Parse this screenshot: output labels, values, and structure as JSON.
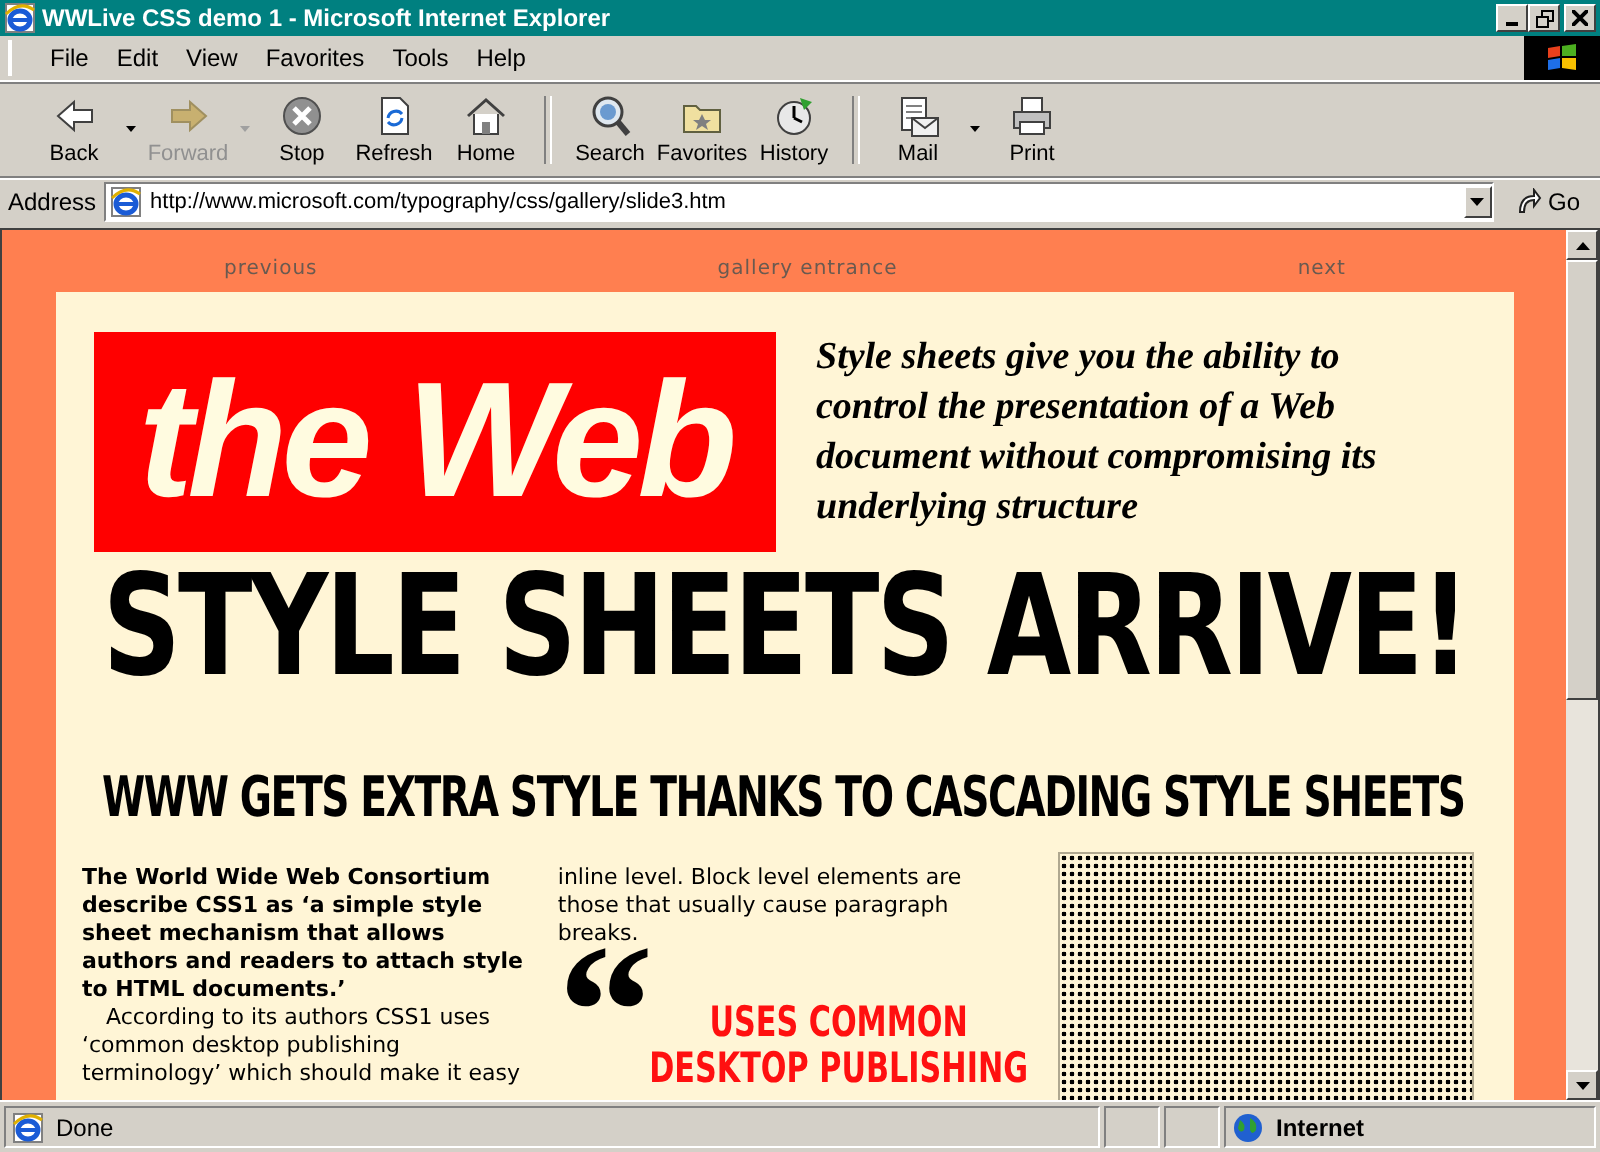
{
  "window": {
    "title": "WWLive CSS demo 1 - Microsoft Internet Explorer"
  },
  "menu": [
    "File",
    "Edit",
    "View",
    "Favorites",
    "Tools",
    "Help"
  ],
  "toolbar": [
    {
      "label": "Back",
      "kind": "back",
      "disabled": false
    },
    {
      "kind": "dropdown",
      "disabled": false
    },
    {
      "label": "Forward",
      "kind": "forward",
      "disabled": true
    },
    {
      "kind": "dropdown",
      "disabled": true
    },
    {
      "label": "Stop",
      "kind": "stop",
      "disabled": false
    },
    {
      "label": "Refresh",
      "kind": "refresh",
      "disabled": false
    },
    {
      "label": "Home",
      "kind": "home",
      "disabled": false
    },
    {
      "kind": "separator"
    },
    {
      "label": "Search",
      "kind": "search",
      "disabled": false
    },
    {
      "label": "Favorites",
      "kind": "favorites",
      "disabled": false
    },
    {
      "label": "History",
      "kind": "history",
      "disabled": false
    },
    {
      "kind": "separator"
    },
    {
      "label": "Mail",
      "kind": "mail",
      "disabled": false
    },
    {
      "kind": "dropdown",
      "disabled": false
    },
    {
      "label": "Print",
      "kind": "print",
      "disabled": false
    }
  ],
  "address": {
    "label": "Address",
    "value": "http://www.microsoft.com/typography/css/gallery/slide3.htm",
    "go": "Go"
  },
  "page": {
    "nav": [
      "previous",
      "gallery entrance",
      "next"
    ],
    "logo": "the Web",
    "intro": "Style sheets give you the ability to control the presentation of a Web document without compromising its underlying structure",
    "headline": "STYLE SHEETS ARRIVE!",
    "subhead": "WWW GETS EXTRA STYLE THANKS TO CASCADING STYLE SHEETS",
    "column_1": {
      "lead": "The World Wide Web Consortium describe CSS1 as ‘a simple style sheet mechanism that allows authors and readers to attach style to HTML documents.’",
      "body": "According to its authors CSS1 uses ‘common desktop publishing terminology’ which should make it easy"
    },
    "column_2": {
      "text": "inline level. Block level elements are those that usually cause paragraph breaks."
    },
    "pull_quote": {
      "mark": "“",
      "lines": [
        "USES COMMON",
        "DESKTOP PUBLISHING"
      ]
    }
  },
  "status_bar": {
    "text": "Done",
    "zone": "Internet"
  }
}
